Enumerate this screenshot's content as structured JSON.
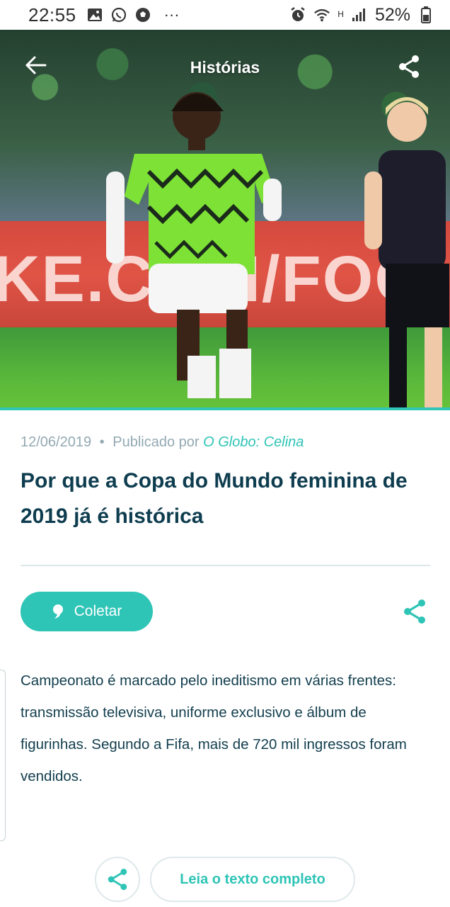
{
  "status_bar": {
    "time": "22:55",
    "battery": "52%",
    "network_type": "H",
    "more_indicator": "···",
    "icons_left": [
      "gallery-icon",
      "whatsapp-icon",
      "soccer-ball-icon"
    ],
    "icons_right": [
      "alarm-icon",
      "wifi-icon",
      "signal-icon",
      "battery-icon"
    ]
  },
  "header": {
    "title": "Histórias",
    "back_icon": "arrow-left-icon",
    "share_icon": "share-icon"
  },
  "hero": {
    "banner_text": "KE.COM/FOO"
  },
  "article": {
    "date": "12/06/2019",
    "separator": "•",
    "published_by_label": "Publicado por",
    "source": "O Globo: Celina",
    "title": "Por que a Copa do Mundo feminina de 2019 já é histórica",
    "summary": "Campeonato é marcado pelo ineditismo em várias frentes: transmissão televisiva, uniforme exclusivo e álbum de figurinhas. Segundo a Fifa, mais de 720 mil ingressos foram vendidos."
  },
  "actions": {
    "collect_label": "Coletar",
    "read_full_label": "Leia o texto completo"
  },
  "colors": {
    "accent": "#2ec4b6",
    "title_text": "#0e3d4f",
    "meta_text": "#93a9b2"
  }
}
